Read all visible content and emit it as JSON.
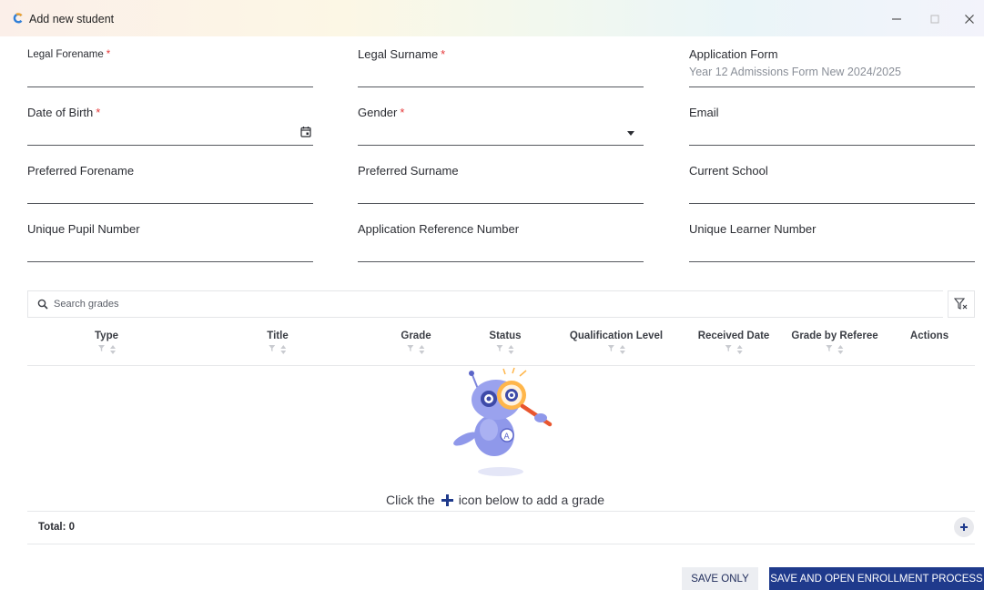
{
  "window": {
    "title": "Add new student",
    "controls": {
      "minimize": "–",
      "maximize": "□",
      "close": "✕"
    }
  },
  "form": {
    "legal_forename": {
      "label": "Legal Forename",
      "required": "*"
    },
    "legal_surname": {
      "label": "Legal Surname",
      "required": "*"
    },
    "application_form": {
      "label": "Application Form",
      "value": "Year 12 Admissions Form New 2024/2025"
    },
    "date_of_birth": {
      "label": "Date of Birth",
      "required": "*"
    },
    "gender": {
      "label": "Gender",
      "required": "*"
    },
    "email": {
      "label": "Email"
    },
    "preferred_forename": {
      "label": "Preferred Forename"
    },
    "preferred_surname": {
      "label": "Preferred Surname"
    },
    "current_school": {
      "label": "Current School"
    },
    "unique_pupil_number": {
      "label": "Unique Pupil Number"
    },
    "application_reference_number": {
      "label": "Application Reference Number"
    },
    "unique_learner_number": {
      "label": "Unique Learner Number"
    }
  },
  "grades": {
    "search_placeholder": "Search grades",
    "columns": [
      "Type",
      "Title",
      "Grade",
      "Status",
      "Qualification Level",
      "Received Date",
      "Grade by Referee",
      "Actions"
    ],
    "empty_text_before": "Click the",
    "empty_text_after": "icon below to add a grade",
    "total_label": "Total:",
    "total_value": "0"
  },
  "footer": {
    "save_only": "SAVE ONLY",
    "save_and_open": "SAVE AND OPEN ENROLLMENT PROCESS"
  },
  "colors": {
    "required": "#e5393a",
    "primary_button": "#1f3a8c",
    "secondary_button": "#eceef2",
    "field_underline": "#55585e"
  },
  "icons": [
    "app-logo-icon",
    "calendar-icon",
    "dropdown-arrow-icon",
    "search-icon",
    "filter-clear-icon",
    "filter-icon",
    "sort-icon",
    "plus-icon",
    "add-circle-icon"
  ]
}
